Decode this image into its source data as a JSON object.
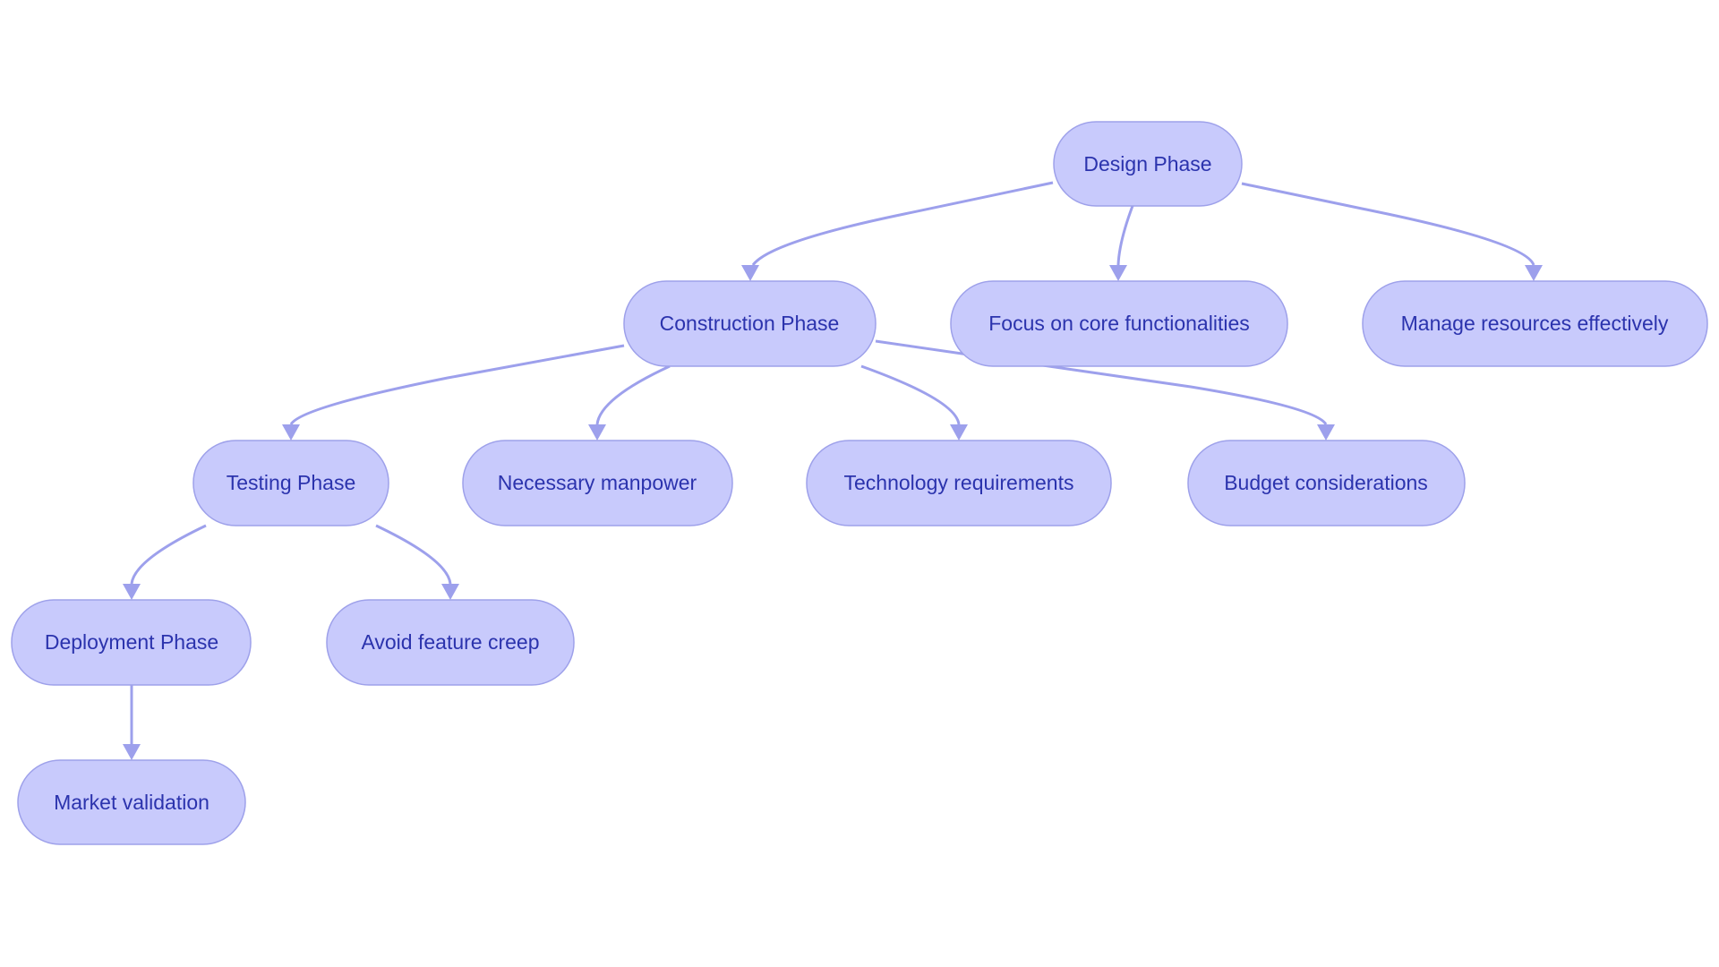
{
  "diagram": {
    "type": "flowchart-tree",
    "colors": {
      "node_fill": "#c8cafc",
      "node_border": "#9ea1ea",
      "edge": "#9da0ec",
      "text": "#2b33ad",
      "background": "#ffffff"
    },
    "nodes": [
      {
        "id": "design",
        "label": "Design Phase"
      },
      {
        "id": "construction",
        "label": "Construction Phase"
      },
      {
        "id": "focus",
        "label": "Focus on core functionalities"
      },
      {
        "id": "manage",
        "label": "Manage resources effectively"
      },
      {
        "id": "testing",
        "label": "Testing Phase"
      },
      {
        "id": "manpower",
        "label": "Necessary manpower"
      },
      {
        "id": "technology",
        "label": "Technology requirements"
      },
      {
        "id": "budget",
        "label": "Budget considerations"
      },
      {
        "id": "deployment",
        "label": "Deployment Phase"
      },
      {
        "id": "creep",
        "label": "Avoid feature creep"
      },
      {
        "id": "market",
        "label": "Market validation"
      }
    ],
    "edges": [
      {
        "from": "design",
        "to": "construction"
      },
      {
        "from": "design",
        "to": "focus"
      },
      {
        "from": "design",
        "to": "manage"
      },
      {
        "from": "construction",
        "to": "testing"
      },
      {
        "from": "construction",
        "to": "manpower"
      },
      {
        "from": "construction",
        "to": "technology"
      },
      {
        "from": "construction",
        "to": "budget"
      },
      {
        "from": "testing",
        "to": "deployment"
      },
      {
        "from": "testing",
        "to": "creep"
      },
      {
        "from": "deployment",
        "to": "market"
      }
    ]
  }
}
